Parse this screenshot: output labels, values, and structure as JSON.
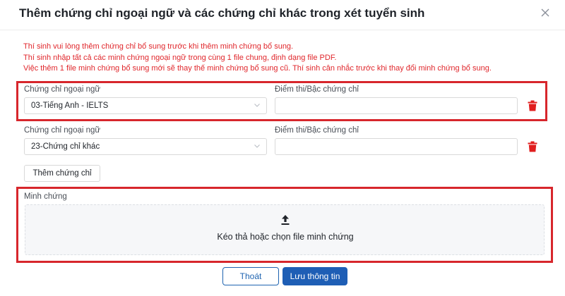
{
  "dialog": {
    "title": "Thêm chứng chỉ ngoại ngữ và các chứng chỉ khác trong xét tuyển sinh",
    "close_icon": "close-icon"
  },
  "notes": [
    "Thí sinh vui lòng thêm chứng chỉ bổ sung trước khi thêm minh chứng bổ sung.",
    "Thí sinh nhập tất cả các minh chứng ngoại ngữ trong cùng 1 file chung, định dạng file PDF.",
    "Việc thêm 1 file minh chứng bổ sung mới sẽ thay thế minh chứng bổ sung cũ. Thí sinh cân nhắc trước khi thay đổi minh chứng bổ sung."
  ],
  "certificates": [
    {
      "cert_label": "Chứng chỉ ngoại ngữ",
      "cert_value": "03-Tiếng Anh - IELTS",
      "score_label": "Điểm thi/Bậc chứng chỉ",
      "score_value": ""
    },
    {
      "cert_label": "Chứng chỉ ngoại ngữ",
      "cert_value": "23-Chứng chỉ khác",
      "score_label": "Điểm thi/Bậc chứng chỉ",
      "score_value": ""
    }
  ],
  "add_button_label": "Thêm chứng chỉ",
  "evidence": {
    "label": "Minh chứng",
    "upload_text": "Kéo thả hoặc chọn file minh chứng"
  },
  "footer": {
    "cancel_label": "Thoát",
    "save_label": "Lưu thông tin"
  },
  "colors": {
    "warning_text": "#e0262b",
    "highlight_border": "#d7262c",
    "primary": "#1e5eb5",
    "delete_icon": "#e01e1e"
  }
}
